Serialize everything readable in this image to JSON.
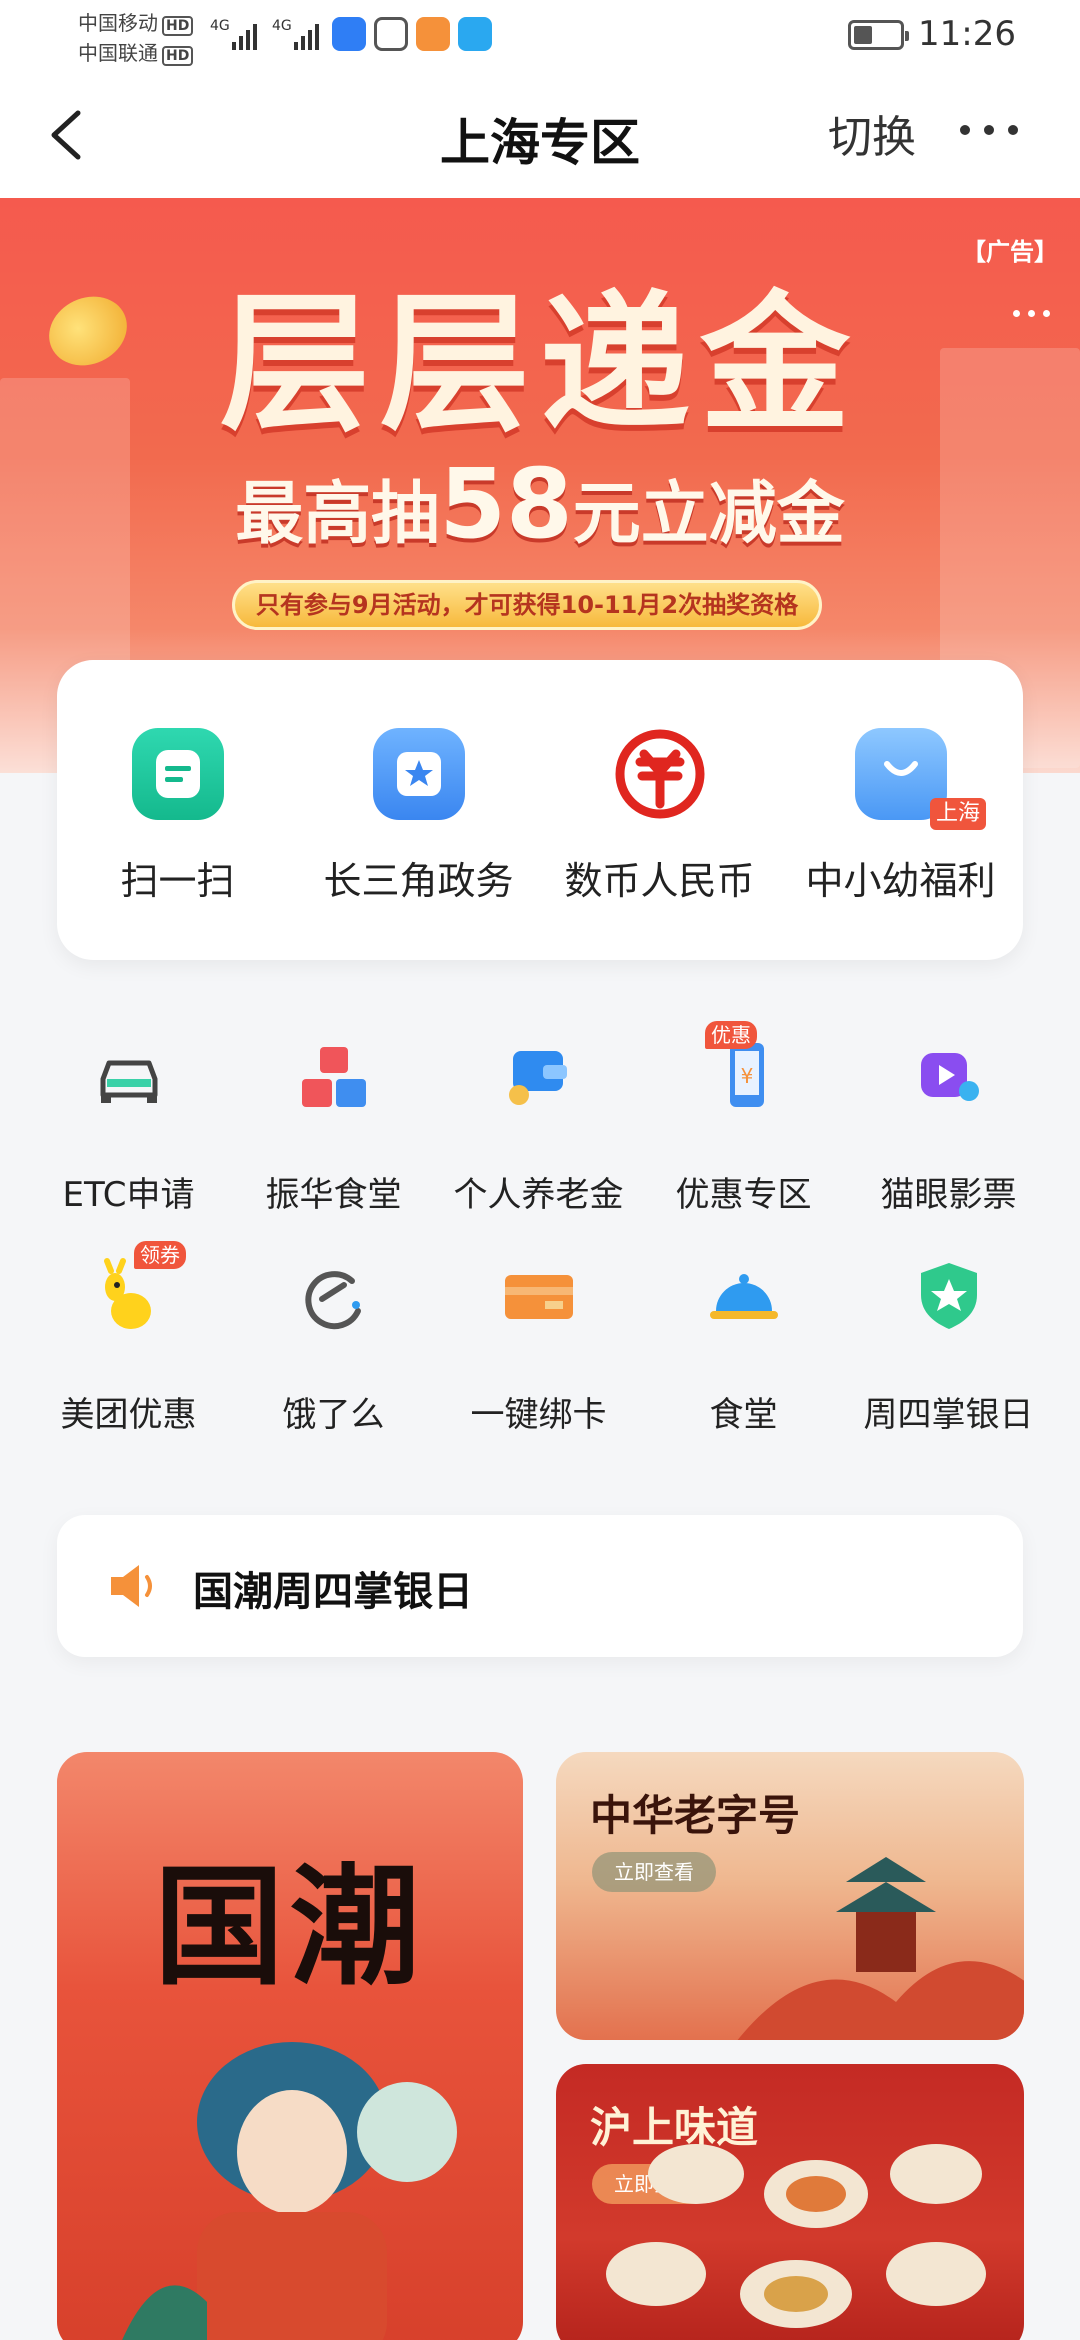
{
  "status_bar": {
    "carrier1": "中国移动",
    "carrier2": "中国联通",
    "hd": "HD",
    "net": "4G",
    "time": "11:26"
  },
  "nav": {
    "title": "上海专区",
    "switch_label": "切换"
  },
  "banner": {
    "ad_tag": "【广告】",
    "headline": "层层递金",
    "sub_prefix": "最高抽",
    "sub_amount": "58",
    "sub_suffix": "元立减金",
    "pill_text": "只有参与9月活动，才可获得10-11月2次抽奖资格"
  },
  "quick_actions": [
    {
      "label": "扫一扫",
      "icon": "scan-icon"
    },
    {
      "label": "长三角政务",
      "icon": "government-star-icon"
    },
    {
      "label": "数币人民币",
      "icon": "digital-rmb-icon"
    },
    {
      "label": "中小幼福利",
      "icon": "shopping-bag-icon",
      "badge": "上海"
    }
  ],
  "services": [
    {
      "label": "ETC申请",
      "icon": "car-icon"
    },
    {
      "label": "振华食堂",
      "icon": "blocks-icon"
    },
    {
      "label": "个人养老金",
      "icon": "wallet-icon"
    },
    {
      "label": "优惠专区",
      "icon": "phone-coupon-icon",
      "badge": "优惠"
    },
    {
      "label": "猫眼影票",
      "icon": "movie-play-icon"
    },
    {
      "label": "美团优惠",
      "icon": "meituan-kangaroo-icon",
      "badge": "领券"
    },
    {
      "label": "饿了么",
      "icon": "eleme-icon"
    },
    {
      "label": "一键绑卡",
      "icon": "bank-card-icon"
    },
    {
      "label": "食堂",
      "icon": "food-cloche-icon"
    },
    {
      "label": "周四掌银日",
      "icon": "star-shield-icon"
    }
  ],
  "notice": {
    "text": "国潮周四掌银日"
  },
  "promos": {
    "card1_title": "国潮",
    "card2_title": "中华老字号",
    "card2_button": "立即查看",
    "card3_title": "沪上味道",
    "card3_button": "立即查看"
  },
  "colors": {
    "banner_red": "#f26a4e",
    "accent_teal": "#1fc9a0",
    "accent_blue": "#4a90f5",
    "rmb_red": "#e0261f"
  }
}
